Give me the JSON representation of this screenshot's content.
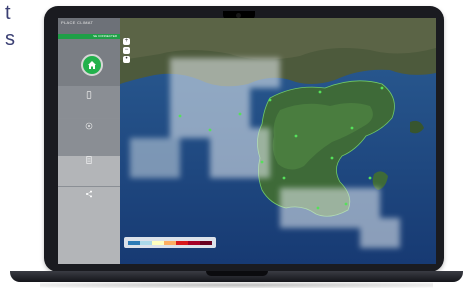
{
  "corner_text": [
    "t",
    "s"
  ],
  "app": {
    "brand_name": "PLACE CLIMAT",
    "brand_sub": "",
    "login_label": "SE CONNECTER",
    "nav": [
      {
        "label": "",
        "icon": "phone-icon"
      },
      {
        "label": "",
        "icon": "eye-icon"
      },
      {
        "label": "",
        "icon": "document-icon"
      },
      {
        "label": "",
        "icon": "share-icon"
      }
    ]
  },
  "map": {
    "legend_title": "",
    "legend_colors": [
      "#2c7bb6",
      "#abd9e9",
      "#ffffbf",
      "#fdae61",
      "#d7191c",
      "#a50026",
      "#67001f"
    ]
  }
}
